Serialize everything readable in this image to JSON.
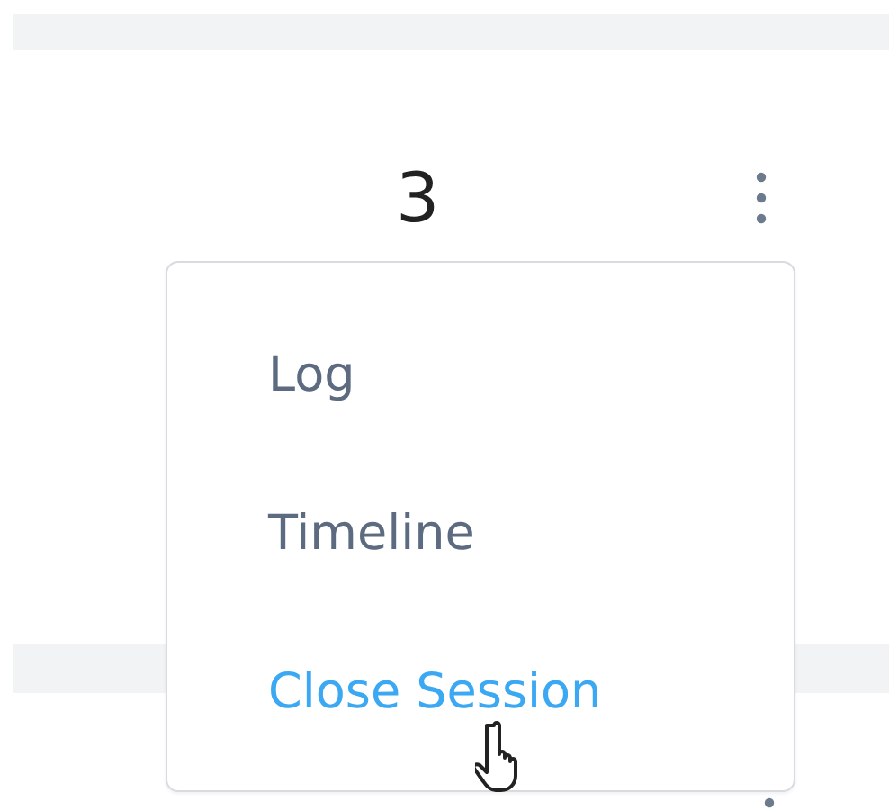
{
  "count": "3",
  "menu": {
    "items": [
      {
        "label": "Log",
        "highlighted": false
      },
      {
        "label": "Timeline",
        "highlighted": false
      },
      {
        "label": "Close Session",
        "highlighted": true
      }
    ]
  }
}
